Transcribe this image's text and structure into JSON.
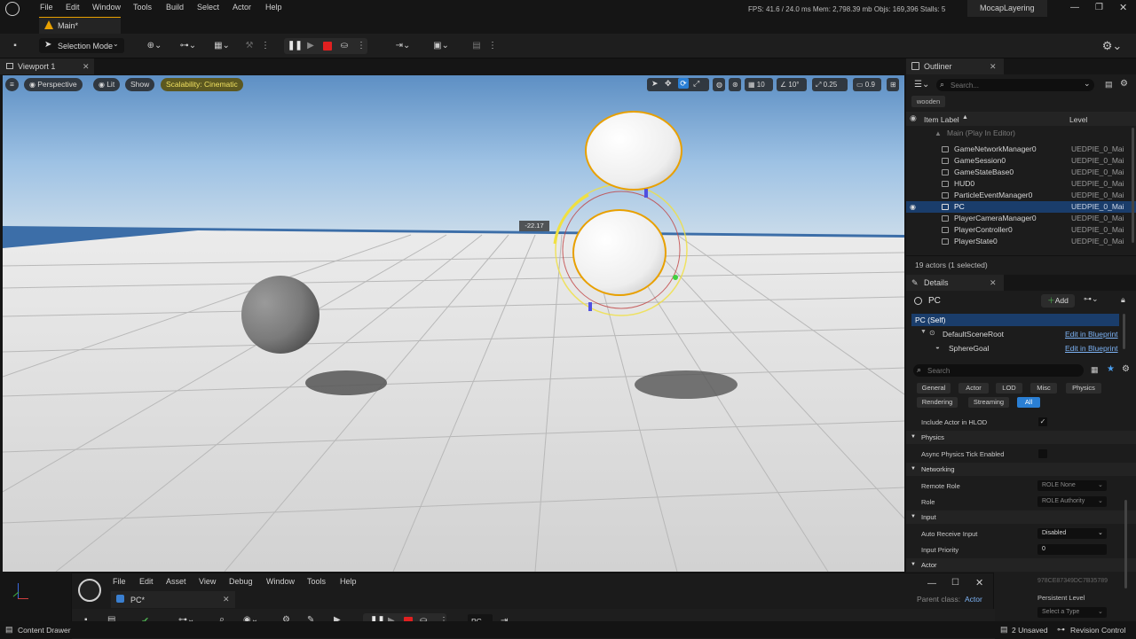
{
  "menubar": {
    "items": [
      "File",
      "Edit",
      "Window",
      "Tools",
      "Build",
      "Select",
      "Actor",
      "Help"
    ],
    "stats": "FPS: 41.6  /  24.0 ms   Mem: 2,798.39 mb   Objs: 169,396   Stalls: 5",
    "project": "MocapLayering"
  },
  "level_tab": {
    "label": "Main*"
  },
  "toolbar": {
    "selection_mode": "Selection Mode"
  },
  "viewport": {
    "tab_label": "Viewport 1",
    "perspective": "Perspective",
    "lit": "Lit",
    "show": "Show",
    "scalability": "Scalability: Cinematic",
    "grid_snap": "10",
    "rotation_snap": "10°",
    "scale_snap": "0.25",
    "camera_speed": "0.9",
    "gizmo_readout": "-22.17"
  },
  "outliner": {
    "tab_label": "Outliner",
    "search_placeholder": "Search...",
    "filter_chip": "wooden",
    "col_label": "Item Label",
    "col_level": "Level",
    "parent_row": "Main (Play In Editor)",
    "rows": [
      {
        "label": "GameNetworkManager0",
        "level": "UEDPIE_0_Main"
      },
      {
        "label": "GameSession0",
        "level": "UEDPIE_0_Main"
      },
      {
        "label": "GameStateBase0",
        "level": "UEDPIE_0_Main"
      },
      {
        "label": "HUD0",
        "level": "UEDPIE_0_Main"
      },
      {
        "label": "ParticleEventManager0",
        "level": "UEDPIE_0_Main"
      },
      {
        "label": "PC",
        "level": "UEDPIE_0_Main"
      },
      {
        "label": "PlayerCameraManager0",
        "level": "UEDPIE_0_Main"
      },
      {
        "label": "PlayerController0",
        "level": "UEDPIE_0_Main"
      },
      {
        "label": "PlayerState0",
        "level": "UEDPIE_0_Main"
      }
    ],
    "footer": "19 actors (1 selected)"
  },
  "details": {
    "tab_label": "Details",
    "actor_name": "PC",
    "add_label": "Add",
    "components": [
      {
        "label": "PC (Self)",
        "action": ""
      },
      {
        "label": "DefaultSceneRoot",
        "action": "Edit in Blueprint"
      },
      {
        "label": "SphereGoal",
        "action": "Edit in Blueprint"
      }
    ],
    "search_placeholder": "Search",
    "filters_row1": [
      "General",
      "Actor",
      "LOD",
      "Misc",
      "Physics"
    ],
    "filters_row2": [
      "Rendering",
      "Streaming",
      "All"
    ],
    "props": {
      "include_hlod": "Include Actor in HLOD",
      "physics_cat": "Physics",
      "async_physics": "Async Physics Tick Enabled",
      "networking_cat": "Networking",
      "remote_role": "Remote Role",
      "remote_role_value": "ROLE None",
      "role": "Role",
      "role_value": "ROLE Authority",
      "input_cat": "Input",
      "auto_receive": "Auto Receive Input",
      "auto_receive_value": "Disabled",
      "input_priority": "Input Priority",
      "input_priority_value": "0",
      "actor_cat": "Actor",
      "guid": "978CE87349DC7B35789",
      "persistent_level": "Persistent Level",
      "select_type": "Select a Type"
    }
  },
  "blueprint_window": {
    "menu": [
      "File",
      "Edit",
      "Asset",
      "View",
      "Debug",
      "Window",
      "Tools",
      "Help"
    ],
    "tab": "PC*",
    "parent_class_label": "Parent class:",
    "parent_class_value": "Actor",
    "dropdown_value": "PC"
  },
  "status": {
    "content_drawer": "Content Drawer",
    "unsaved": "2 Unsaved",
    "revision_control": "Revision Control"
  },
  "colors": {
    "accent": "#2a7fd4",
    "selection": "#1a3d6b",
    "gizmo_yellow": "#f0e040",
    "stop_red": "#e02020"
  }
}
